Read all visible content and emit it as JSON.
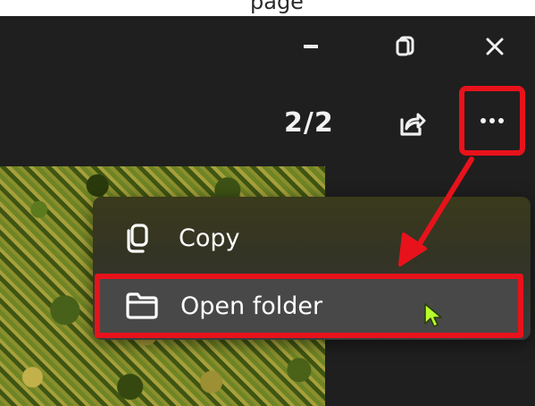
{
  "top_strip": {
    "caption": "page"
  },
  "window_controls": {
    "minimize_icon": "minimize-icon",
    "restore_icon": "restore-icon",
    "close_icon": "close-icon"
  },
  "toolbar": {
    "counter": "2/2",
    "share_icon": "share-icon",
    "more_icon": "more-options-icon"
  },
  "context_menu": {
    "items": [
      {
        "label": "Copy",
        "icon": "copy-icon"
      },
      {
        "label": "Open folder",
        "icon": "folder-icon"
      }
    ]
  },
  "colors": {
    "annotation_red": "#e8121b",
    "cursor_green": "#b6ff2a",
    "background": "#1f1f1f"
  }
}
